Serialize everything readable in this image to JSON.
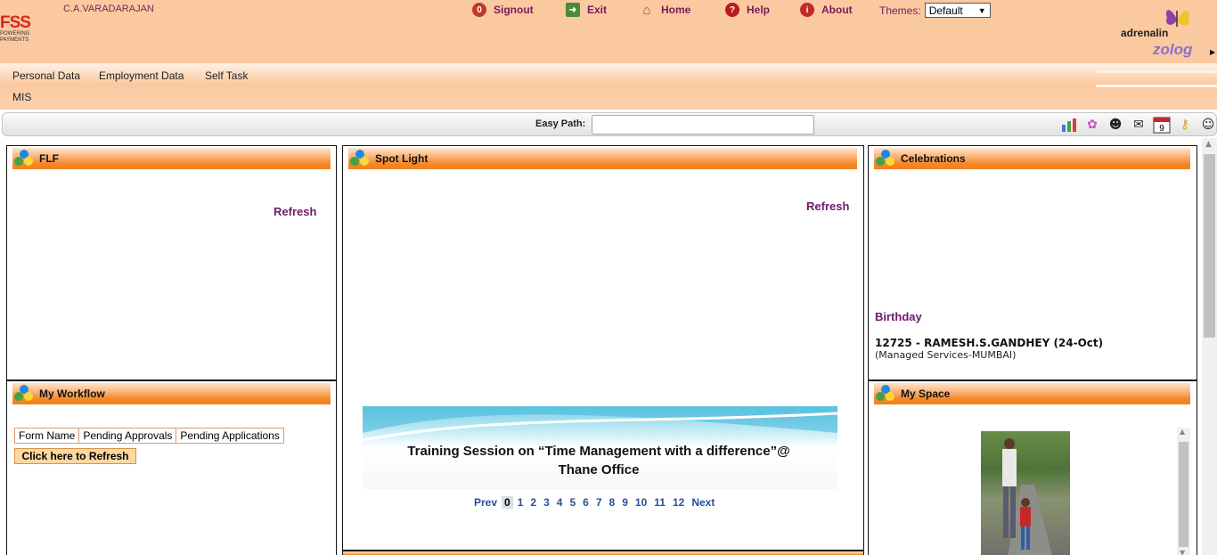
{
  "header": {
    "logo_text": "FSS",
    "logo_tagline": "POWERING PAYMENTS",
    "username": "C.A.VARADARAJAN",
    "nav": [
      {
        "label": "Signout",
        "icon": "signout-icon"
      },
      {
        "label": "Exit",
        "icon": "exit-icon"
      },
      {
        "label": "Home",
        "icon": "home-icon"
      },
      {
        "label": "Help",
        "icon": "help-icon"
      },
      {
        "label": "About",
        "icon": "info-icon"
      }
    ],
    "themes_label": "Themes:",
    "theme_selected": "Default",
    "brand_top": "adrenalin",
    "brand_bottom": "zolog"
  },
  "menu": {
    "items": [
      "Personal Data",
      "Employment Data",
      "Self Task",
      "MIS"
    ]
  },
  "easy_path": {
    "label": "Easy Path:",
    "value": ""
  },
  "toolbar_icons": [
    "chart-icon",
    "gear-icon",
    "help-person-icon",
    "mail-icon",
    "calendar-icon",
    "key-icon",
    "user-icon"
  ],
  "calendar_day": "9",
  "flf": {
    "title": "FLF",
    "refresh": "Refresh"
  },
  "workflow": {
    "title": "My Workflow",
    "columns": [
      "Form Name",
      "Pending Approvals",
      "Pending Applications"
    ],
    "refresh_button": "Click here to Refresh"
  },
  "spotlight": {
    "title": "Spot Light",
    "refresh": "Refresh",
    "banner_line1": "Training Session on “Time Management with a difference”@",
    "banner_line2": "Thane Office",
    "pager": {
      "prev": "Prev",
      "pages": [
        "0",
        "1",
        "2",
        "3",
        "4",
        "5",
        "6",
        "7",
        "8",
        "9",
        "10",
        "11",
        "12"
      ],
      "current": "0",
      "next": "Next"
    }
  },
  "celebrations": {
    "title": "Celebrations",
    "section": "Birthday",
    "entry": "12725 - RAMESH.S.GANDHEY (24-Oct)",
    "dept": "(Managed Services-MUMBAI)"
  },
  "myspace": {
    "title": "My Space"
  },
  "colors": {
    "header_bg": "#fbc99f",
    "panel_header": "#f48728",
    "link_purple": "#6d1a6a",
    "pager_blue": "#2a4f9a"
  }
}
